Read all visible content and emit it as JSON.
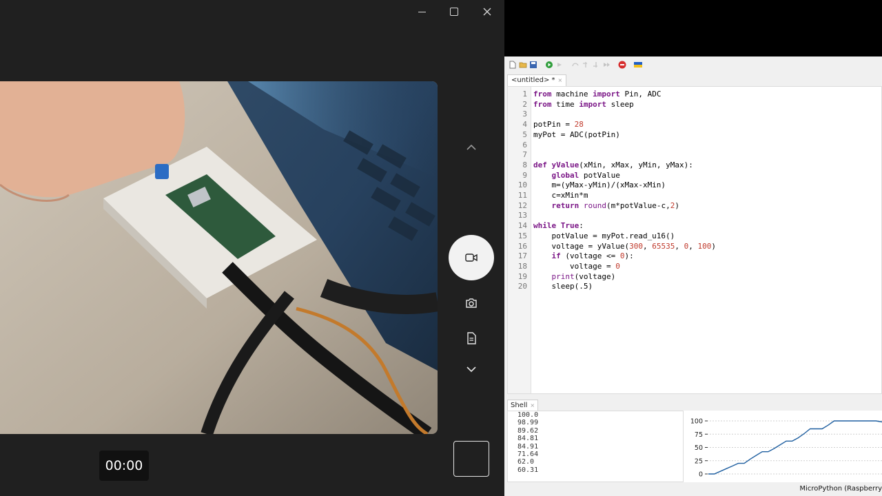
{
  "camera": {
    "timer": "00:00"
  },
  "ide": {
    "tab_label": "<untitled> *",
    "tab_close": "×",
    "code_lines": [
      {
        "n": "1",
        "parts": [
          [
            "kw",
            "from"
          ],
          [
            "t",
            " machine "
          ],
          [
            "kw",
            "import"
          ],
          [
            "t",
            " Pin, ADC"
          ]
        ]
      },
      {
        "n": "2",
        "parts": [
          [
            "kw",
            "from"
          ],
          [
            "t",
            " time "
          ],
          [
            "kw",
            "import"
          ],
          [
            "t",
            " sleep"
          ]
        ]
      },
      {
        "n": "3",
        "parts": []
      },
      {
        "n": "4",
        "parts": [
          [
            "t",
            "potPin = "
          ],
          [
            "num",
            "28"
          ]
        ]
      },
      {
        "n": "5",
        "parts": [
          [
            "t",
            "myPot = ADC(potPin)"
          ]
        ]
      },
      {
        "n": "6",
        "parts": []
      },
      {
        "n": "7",
        "parts": []
      },
      {
        "n": "8",
        "parts": [
          [
            "kw",
            "def"
          ],
          [
            "t",
            " "
          ],
          [
            "kw",
            "yValue"
          ],
          [
            "t",
            "(xMin, xMax, yMin, yMax):"
          ]
        ]
      },
      {
        "n": "9",
        "parts": [
          [
            "t",
            "    "
          ],
          [
            "kw",
            "global"
          ],
          [
            "t",
            " potValue"
          ]
        ]
      },
      {
        "n": "10",
        "parts": [
          [
            "t",
            "    m=(yMax-yMin)/(xMax-xMin)"
          ]
        ]
      },
      {
        "n": "11",
        "parts": [
          [
            "t",
            "    c=xMin*m"
          ]
        ]
      },
      {
        "n": "12",
        "parts": [
          [
            "t",
            "    "
          ],
          [
            "kw",
            "return"
          ],
          [
            "t",
            " "
          ],
          [
            "bi",
            "round"
          ],
          [
            "t",
            "(m*potValue-c,"
          ],
          [
            "num",
            "2"
          ],
          [
            "t",
            ")"
          ]
        ]
      },
      {
        "n": "13",
        "parts": []
      },
      {
        "n": "14",
        "parts": [
          [
            "kw",
            "while"
          ],
          [
            "t",
            " "
          ],
          [
            "kw",
            "True"
          ],
          [
            "t",
            ":"
          ]
        ]
      },
      {
        "n": "15",
        "parts": [
          [
            "t",
            "    potValue = myPot.read_u16()"
          ]
        ]
      },
      {
        "n": "16",
        "parts": [
          [
            "t",
            "    voltage = yValue("
          ],
          [
            "num",
            "300"
          ],
          [
            "t",
            ", "
          ],
          [
            "num",
            "65535"
          ],
          [
            "t",
            ", "
          ],
          [
            "num",
            "0"
          ],
          [
            "t",
            ", "
          ],
          [
            "num",
            "100"
          ],
          [
            "t",
            ")"
          ]
        ]
      },
      {
        "n": "17",
        "parts": [
          [
            "t",
            "    "
          ],
          [
            "kw",
            "if"
          ],
          [
            "t",
            " (voltage <= "
          ],
          [
            "num",
            "0"
          ],
          [
            "t",
            "):"
          ]
        ]
      },
      {
        "n": "18",
        "parts": [
          [
            "t",
            "        voltage = "
          ],
          [
            "num",
            "0"
          ]
        ]
      },
      {
        "n": "19",
        "parts": [
          [
            "t",
            "    "
          ],
          [
            "bi",
            "print"
          ],
          [
            "t",
            "(voltage)"
          ]
        ]
      },
      {
        "n": "20",
        "parts": [
          [
            "t",
            "    sleep(.5)"
          ]
        ]
      }
    ],
    "shell_tab_label": "Shell",
    "shell_tab_close": "×",
    "shell_lines": [
      "100.0",
      "98.99",
      "89.62",
      "84.81",
      "84.91",
      "71.64",
      "62.0",
      "60.31"
    ],
    "plot_ticks": [
      "100",
      "75",
      "50",
      "25",
      "0"
    ],
    "status": "MicroPython (Raspberry"
  },
  "colors": {
    "keyword": "#7a1586",
    "number": "#c0392b",
    "plot_line": "#1f5fa0"
  },
  "icons": {
    "window": [
      "minimize-icon",
      "maximize-icon",
      "close-icon"
    ],
    "camera_side": [
      "chevron-up-icon",
      "video-camera-icon",
      "camera-icon",
      "document-icon",
      "chevron-down-icon"
    ],
    "toolbar": [
      "new-file-icon",
      "open-folder-icon",
      "save-icon",
      "run-icon",
      "debug-icon",
      "step-over-icon",
      "step-into-icon",
      "step-out-icon",
      "resume-icon",
      "stop-icon",
      "ukraine-flag-icon"
    ]
  }
}
